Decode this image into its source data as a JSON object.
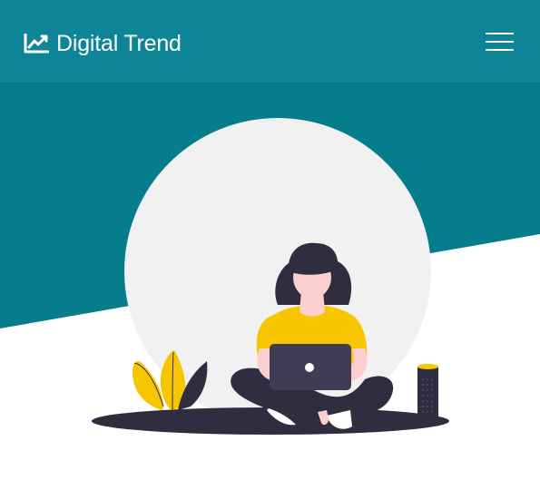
{
  "navbar": {
    "brand_name": "Digital Trend",
    "brand_icon": "chart-line-icon",
    "menu_icon": "hamburger-menu-icon"
  },
  "hero": {
    "illustration": "woman-working-on-laptop",
    "colors": {
      "accent": "#067d8c",
      "navbar": "#0e8597",
      "yellow": "#f7c600",
      "dark": "#2f2e41",
      "circle": "#f1f1f1"
    }
  }
}
